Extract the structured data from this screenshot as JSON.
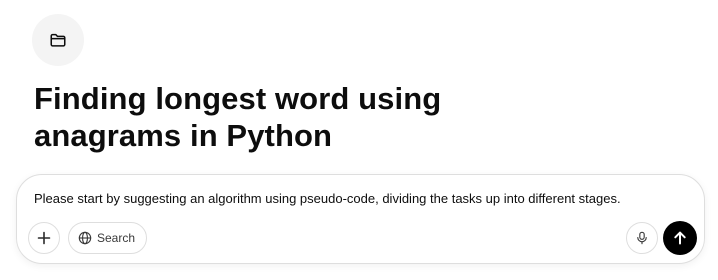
{
  "project": {
    "icon": "folder-icon",
    "title": "Finding longest word using anagrams in Python"
  },
  "composer": {
    "prompt_text": "Please start by suggesting an algorithm using pseudo-code, dividing the tasks up into different stages.",
    "add_icon": "plus-icon",
    "search": {
      "icon": "globe-icon",
      "label": "Search"
    },
    "mic_icon": "microphone-icon",
    "send_icon": "arrow-up-icon"
  },
  "colors": {
    "background": "#ffffff",
    "text": "#0d0d0d",
    "icon_button_bg": "#f4f4f4",
    "border": "#dedede",
    "send_button": "#000000"
  }
}
